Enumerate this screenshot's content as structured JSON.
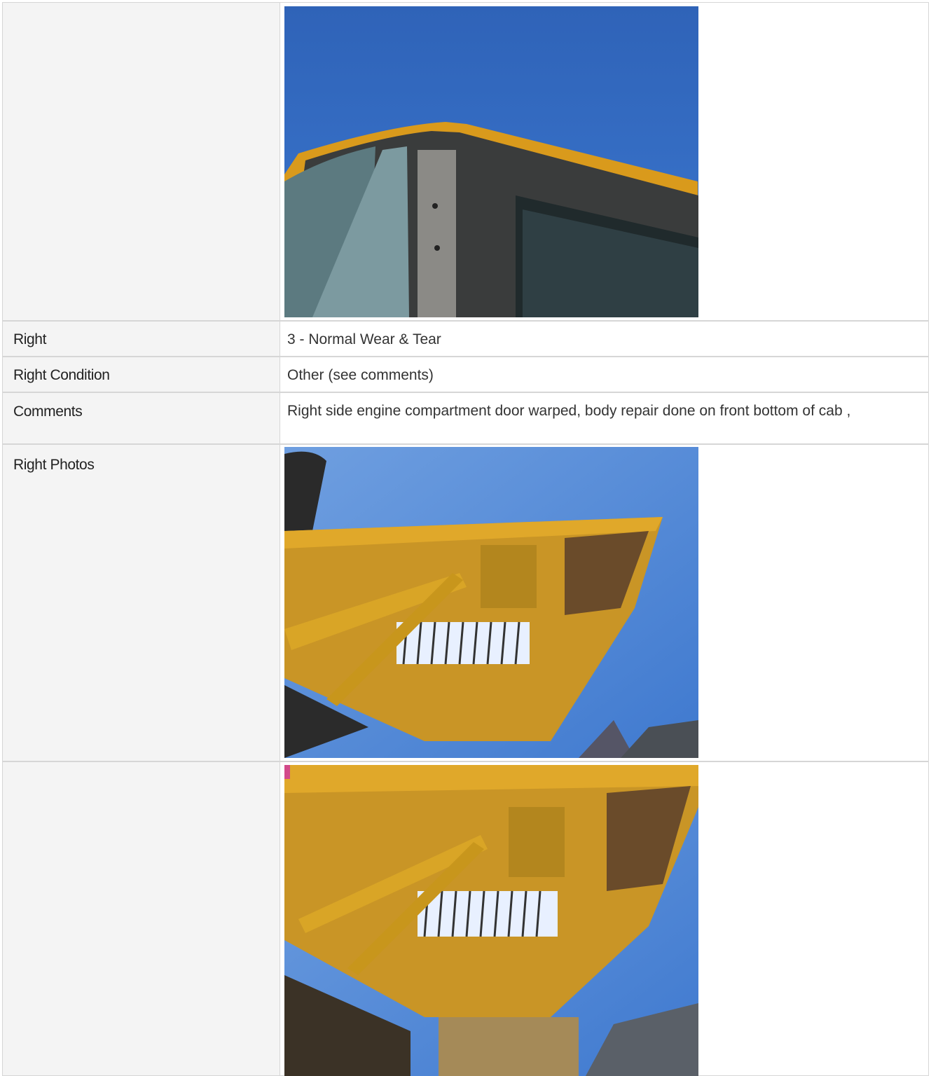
{
  "rows": [
    {
      "label": "",
      "kind": "photo"
    },
    {
      "label": "Right",
      "value": "3 - Normal Wear & Tear"
    },
    {
      "label": "Right Condition",
      "value": "Other (see comments)"
    },
    {
      "label": "Comments",
      "value": "Right side engine compartment door warped, body repair done on front bottom of cab ,"
    },
    {
      "label": "Right Photos",
      "kind": "photo"
    },
    {
      "label": "",
      "kind": "photo"
    }
  ],
  "colors": {
    "label_bg": "#f4f4f4",
    "border": "#d6d6d6",
    "sky": "#3f72c4",
    "machine_yellow": "#e0a320"
  }
}
